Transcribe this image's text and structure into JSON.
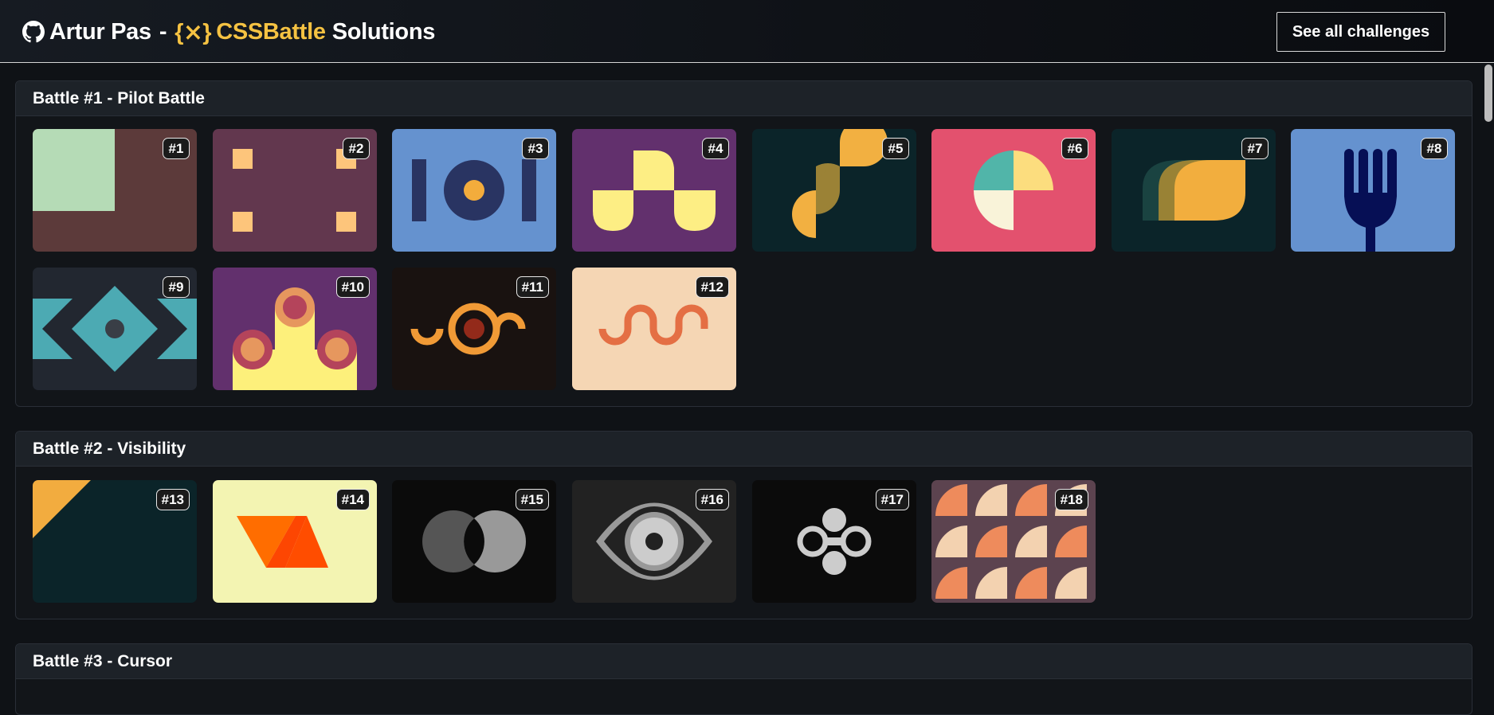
{
  "header": {
    "author": "Artur Pas",
    "separator": "-",
    "logo_glyph": "{⨯}",
    "site": "CSSBattle",
    "suffix": "Solutions",
    "github_icon": "github-icon",
    "see_all_label": "See all challenges"
  },
  "battles": [
    {
      "title": "Battle #1 - Pilot Battle",
      "challenges": [
        {
          "label": "#1",
          "bg": "#5c3a3a"
        },
        {
          "label": "#2",
          "bg": "#62374e"
        },
        {
          "label": "#3",
          "bg": "#6592cf"
        },
        {
          "label": "#4",
          "bg": "#62306d"
        },
        {
          "label": "#5",
          "bg": "#0b2429"
        },
        {
          "label": "#6",
          "bg": "#e3516e"
        },
        {
          "label": "#7",
          "bg": "#0b2429"
        },
        {
          "label": "#8",
          "bg": "#6592cf"
        },
        {
          "label": "#9",
          "bg": "#222730"
        },
        {
          "label": "#10",
          "bg": "#62306d"
        },
        {
          "label": "#11",
          "bg": "#191210"
        },
        {
          "label": "#12",
          "bg": "#f5d6b4"
        }
      ]
    },
    {
      "title": "Battle #2 - Visibility",
      "challenges": [
        {
          "label": "#13",
          "bg": "#0b2429"
        },
        {
          "label": "#14",
          "bg": "#f3f4b2"
        },
        {
          "label": "#15",
          "bg": "#0b0b0b"
        },
        {
          "label": "#16",
          "bg": "#222222"
        },
        {
          "label": "#17",
          "bg": "#0b0b0b"
        },
        {
          "label": "#18",
          "bg": "#5c434f"
        }
      ]
    },
    {
      "title": "Battle #3 - Cursor",
      "challenges": []
    }
  ]
}
